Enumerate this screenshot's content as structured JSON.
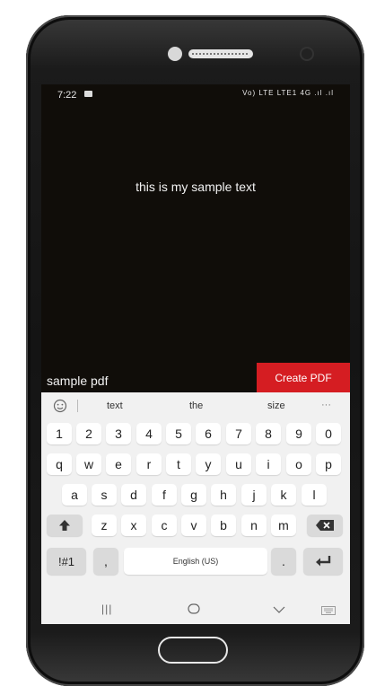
{
  "status_bar": {
    "time": "7:22",
    "network": "Vo) LTE LTE1 4G .ıl .ıl"
  },
  "content": {
    "text": "this is my sample text"
  },
  "pdf": {
    "name": "sample pdf",
    "create_label": "Create PDF"
  },
  "suggestions": [
    "text",
    "the",
    "size",
    "···"
  ],
  "keyboard": {
    "row1": [
      "1",
      "2",
      "3",
      "4",
      "5",
      "6",
      "7",
      "8",
      "9",
      "0"
    ],
    "row2": [
      "q",
      "w",
      "e",
      "r",
      "t",
      "y",
      "u",
      "i",
      "o",
      "p"
    ],
    "row3": [
      "a",
      "s",
      "d",
      "f",
      "g",
      "h",
      "j",
      "k",
      "l"
    ],
    "row4": [
      "z",
      "x",
      "c",
      "v",
      "b",
      "n",
      "m"
    ],
    "symbols_label": "!#1",
    "comma": ",",
    "space_label": "English (US)",
    "period": "."
  },
  "icons": {
    "shift": "shift-icon",
    "backspace": "backspace-icon",
    "enter": "enter-icon",
    "emoji": "emoji-icon",
    "keyboard_hide": "chevron-down-icon"
  },
  "colors": {
    "accent": "#d51d22",
    "screen_bg": "#100d09",
    "keyboard_bg": "#f1f1f1"
  }
}
